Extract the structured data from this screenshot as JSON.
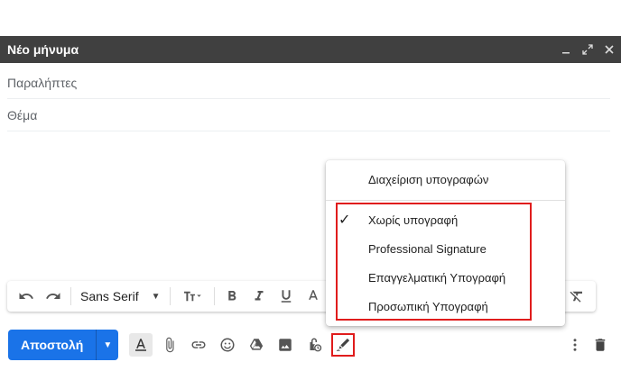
{
  "compose": {
    "title": "Νέο μήνυμα",
    "to_placeholder": "Παραλήπτες",
    "subject_placeholder": "Θέμα"
  },
  "format_bar": {
    "font": "Sans Serif"
  },
  "bottom": {
    "send_label": "Αποστολή"
  },
  "signature_menu": {
    "manage_label": "Διαχείριση υπογραφών",
    "items": [
      {
        "label": "Χωρίς υπογραφή",
        "checked": true
      },
      {
        "label": "Professional Signature",
        "checked": false
      },
      {
        "label": "Επαγγελματική Υπογραφή",
        "checked": false
      },
      {
        "label": "Προσωπική Υπογραφή",
        "checked": false
      }
    ],
    "check_glyph": "✓"
  },
  "colors": {
    "titlebar": "#404040",
    "send": "#1a73e8",
    "highlight": "#e01c1c"
  }
}
